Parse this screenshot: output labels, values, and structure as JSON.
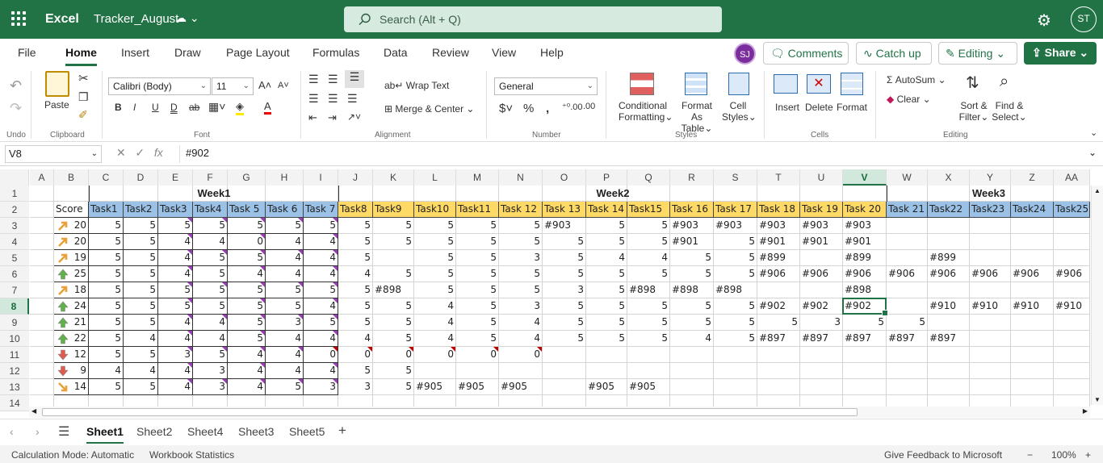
{
  "titlebar": {
    "app": "Excel",
    "document": "Tracker_August",
    "search_placeholder": "Search (Alt + Q)",
    "user_initials": "ST"
  },
  "menu": {
    "tabs": [
      "File",
      "Home",
      "Insert",
      "Draw",
      "Page Layout",
      "Formulas",
      "Data",
      "Review",
      "View",
      "Help"
    ],
    "active": "Home",
    "coauthor": "SJ",
    "comments": "Comments",
    "catchup": "Catch up",
    "editing": "Editing",
    "share": "Share"
  },
  "ribbon": {
    "undo_group": "Undo",
    "clipboard": {
      "paste": "Paste",
      "group": "Clipboard"
    },
    "font": {
      "name": "Calibri (Body)",
      "size": "11",
      "group": "Font"
    },
    "alignment": {
      "wrap": "Wrap Text",
      "merge": "Merge & Center",
      "group": "Alignment"
    },
    "number": {
      "format": "General",
      "group": "Number"
    },
    "styles": {
      "conditional": "Conditional",
      "formatting": "Formatting",
      "format_as": "Format As",
      "table": "Table",
      "cell": "Cell",
      "cell_styles": "Styles",
      "group": "Styles"
    },
    "cells": {
      "insert": "Insert",
      "delete": "Delete",
      "format": "Format",
      "group": "Cells"
    },
    "editing": {
      "autosum": "AutoSum",
      "clear": "Clear",
      "sort": "Sort &",
      "filter": "Filter",
      "find": "Find &",
      "select": "Select",
      "group": "Editing"
    }
  },
  "formula_bar": {
    "name_box": "V8",
    "value": "#902"
  },
  "columns": [
    "A",
    "B",
    "C",
    "D",
    "E",
    "F",
    "G",
    "H",
    "I",
    "J",
    "K",
    "L",
    "M",
    "N",
    "O",
    "P",
    "Q",
    "R",
    "S",
    "T",
    "U",
    "V",
    "W",
    "X",
    "Y",
    "Z",
    "AA"
  ],
  "selected_column": "V",
  "rows": [
    "1",
    "2",
    "3",
    "4",
    "5",
    "6",
    "7",
    "8",
    "9",
    "10",
    "11",
    "12",
    "13",
    "14"
  ],
  "selected_row": "8",
  "week_labels": {
    "week1": "Week1",
    "week2": "Week2",
    "week3": "Week3"
  },
  "header_row": [
    "Score",
    "Task1",
    "Task2",
    "Task3",
    "Task4",
    "Task 5",
    "Task 6",
    "Task 7",
    "Task8",
    "Task9",
    "Task10",
    "Task11",
    "Task 12",
    "Task 13",
    "Task 14",
    "Task15",
    "Task 16",
    "Task 17",
    "Task 18",
    "Task 19",
    "Task 20",
    "Task 21",
    "Task22",
    "Task23",
    "Task24",
    "Task25"
  ],
  "data_rows": [
    {
      "arrow": "up-right",
      "score": "20",
      "cells": [
        "5",
        "5",
        "5",
        "5",
        "5",
        "5",
        "5",
        "5",
        "5",
        "5",
        "5",
        "5",
        "#903",
        "5",
        "5",
        "#903",
        "#903",
        "#903",
        "#903",
        "#903",
        "",
        "",
        "",
        "",
        ""
      ]
    },
    {
      "arrow": "up-right",
      "score": "20",
      "cells": [
        "5",
        "5",
        "4",
        "4",
        "0",
        "4",
        "4",
        "5",
        "5",
        "5",
        "5",
        "5",
        "5",
        "5",
        "5",
        "#901",
        "5",
        "#901",
        "#901",
        "#901",
        "",
        "",
        "",
        "",
        ""
      ]
    },
    {
      "arrow": "up-right",
      "score": "19",
      "cells": [
        "5",
        "5",
        "4",
        "5",
        "5",
        "4",
        "4",
        "5",
        "",
        "5",
        "5",
        "3",
        "5",
        "4",
        "4",
        "5",
        "5",
        "#899",
        "",
        "#899",
        "",
        "#899",
        "",
        "",
        ""
      ]
    },
    {
      "arrow": "up",
      "score": "25",
      "cells": [
        "5",
        "5",
        "4",
        "5",
        "4",
        "4",
        "4",
        "4",
        "5",
        "5",
        "5",
        "5",
        "5",
        "5",
        "5",
        "5",
        "5",
        "#906",
        "#906",
        "#906",
        "#906",
        "#906",
        "#906",
        "#906",
        "#906"
      ]
    },
    {
      "arrow": "up-right",
      "score": "18",
      "cells": [
        "5",
        "5",
        "5",
        "5",
        "5",
        "5",
        "5",
        "5",
        "#898",
        "5",
        "5",
        "5",
        "3",
        "5",
        "#898",
        "#898",
        "#898",
        "",
        "",
        "#898",
        "",
        "",
        "",
        "",
        ""
      ]
    },
    {
      "arrow": "up",
      "score": "24",
      "cells": [
        "5",
        "5",
        "5",
        "5",
        "5",
        "5",
        "4",
        "5",
        "5",
        "4",
        "5",
        "3",
        "5",
        "5",
        "5",
        "5",
        "5",
        "#902",
        "#902",
        "#902",
        "",
        "#910",
        "#910",
        "#910",
        "#910"
      ]
    },
    {
      "arrow": "up",
      "score": "21",
      "cells": [
        "5",
        "5",
        "4",
        "4",
        "5",
        "3",
        "5",
        "5",
        "5",
        "4",
        "5",
        "4",
        "5",
        "5",
        "5",
        "5",
        "5",
        "5",
        "3",
        "5",
        "5",
        "",
        "",
        "",
        ""
      ]
    },
    {
      "arrow": "up",
      "score": "22",
      "cells": [
        "5",
        "4",
        "4",
        "4",
        "5",
        "4",
        "4",
        "4",
        "5",
        "4",
        "5",
        "4",
        "5",
        "5",
        "5",
        "4",
        "5",
        "#897",
        "#897",
        "#897",
        "#897",
        "#897",
        "",
        "",
        ""
      ]
    },
    {
      "arrow": "down",
      "score": "12",
      "cells": [
        "5",
        "5",
        "3",
        "5",
        "4",
        "4",
        "0",
        "0",
        "0",
        "0",
        "0",
        "0",
        "",
        "",
        "",
        "",
        "",
        "",
        "",
        "",
        "",
        "",
        "",
        "",
        ""
      ]
    },
    {
      "arrow": "down",
      "score": "9",
      "cells": [
        "4",
        "4",
        "4",
        "3",
        "4",
        "4",
        "4",
        "5",
        "5",
        "",
        "",
        "",
        "",
        "",
        "",
        "",
        "",
        "",
        "",
        "",
        "",
        "",
        "",
        "",
        ""
      ]
    },
    {
      "arrow": "down-right",
      "score": "14",
      "cells": [
        "5",
        "5",
        "4",
        "3",
        "4",
        "5",
        "3",
        "3",
        "5",
        "#905",
        "#905",
        "#905",
        "",
        "#905",
        "#905",
        "",
        "",
        "",
        "",
        "",
        "",
        "",
        "",
        "",
        ""
      ]
    }
  ],
  "sheets": {
    "tabs": [
      "Sheet1",
      "Sheet2",
      "Sheet4",
      "Sheet3",
      "Sheet5"
    ],
    "active": "Sheet1"
  },
  "status": {
    "calc": "Calculation Mode: Automatic",
    "stats": "Workbook Statistics",
    "feedback": "Give Feedback to Microsoft",
    "zoom": "100%"
  }
}
